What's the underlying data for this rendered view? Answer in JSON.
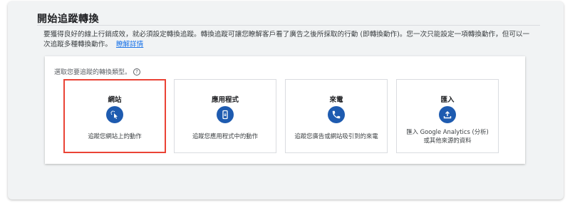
{
  "page": {
    "title": "開始追蹤轉換",
    "description": "要獲得良好的線上行銷成效，就必須設定轉換追蹤。轉換追蹤可讓您瞭解客戶看了廣告之後所採取的行動 (即轉換動作)。您一次只能設定一項轉換動作，但可以一次追蹤多種轉換動作。",
    "learn_more": "瞭解詳情"
  },
  "panel": {
    "prompt": "選取您要追蹤的轉換類型。",
    "help_icon": "?"
  },
  "cards": [
    {
      "title": "網站",
      "description": "追蹤您網站上的動作",
      "icon": "cursor-click-icon",
      "selected": true
    },
    {
      "title": "應用程式",
      "description": "追蹤您應用程式中的動作",
      "icon": "phone-app-icon",
      "selected": false
    },
    {
      "title": "來電",
      "description": "追蹤您廣告或網站吸引到的來電",
      "icon": "phone-call-icon",
      "selected": false
    },
    {
      "title": "匯入",
      "description": "匯入 Google Analytics (分析) 或其他來源的資料",
      "icon": "upload-icon",
      "selected": false
    }
  ],
  "colors": {
    "icon_bg": "#1e5bb0",
    "selected_border": "#ea4335",
    "link": "#1a73e8",
    "background": "#f1f3f4"
  }
}
